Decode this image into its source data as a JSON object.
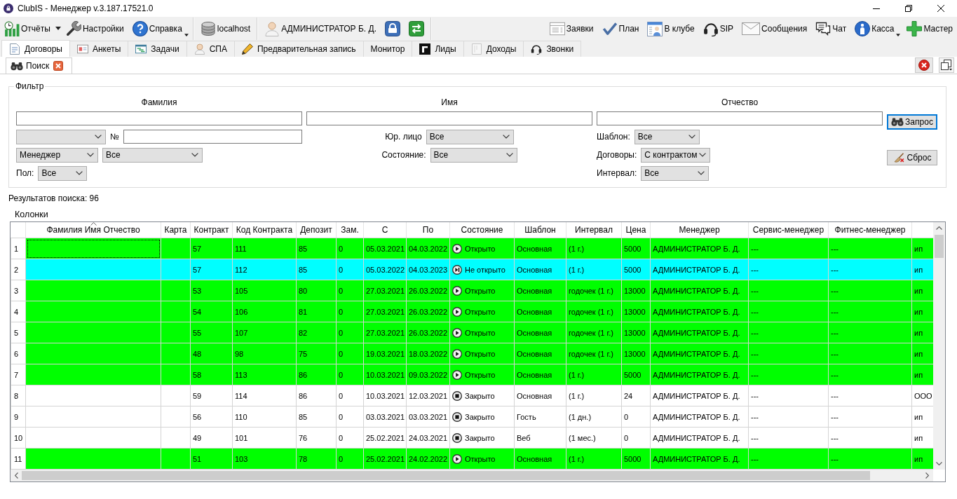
{
  "window": {
    "title": "ClubIS - Менеджер v.3.187.17521.0"
  },
  "toolbar": {
    "left_groups": [
      [
        {
          "kind": "reports",
          "label": "Отчёты",
          "dropdown": true,
          "split": true
        },
        {
          "kind": "settings",
          "label": "Настройки",
          "dropdown": false
        },
        {
          "kind": "help",
          "label": "Справка",
          "dropdown": true,
          "split": false
        }
      ],
      [
        {
          "kind": "server",
          "label": "localhost",
          "dropdown": false
        }
      ],
      [
        {
          "kind": "user",
          "label": "АДМИНИСТРАТОР Б. Д.",
          "dropdown": false
        },
        {
          "kind": "lock",
          "dropdown": false
        },
        {
          "kind": "switch",
          "dropdown": false
        }
      ]
    ],
    "right": [
      {
        "kind": "requests",
        "label": "Заявки",
        "dropdown": false
      },
      {
        "kind": "plan",
        "label": "План",
        "dropdown": false
      },
      {
        "kind": "in_club",
        "label": "В клубе",
        "dropdown": false
      },
      {
        "kind": "sip",
        "label": "SIP",
        "dropdown": false
      },
      {
        "kind": "messages",
        "label": "Сообщения",
        "dropdown": false
      },
      {
        "kind": "chat",
        "label": "Чат",
        "dropdown": false
      },
      {
        "kind": "cash",
        "label": "Касса",
        "dropdown": true,
        "split": false
      },
      {
        "kind": "wizard",
        "label": "Мастер",
        "dropdown": false
      }
    ]
  },
  "tabs": [
    {
      "kind": "contracts",
      "label": "Договоры",
      "selected": true
    },
    {
      "kind": "forms",
      "label": "Анкеты",
      "selected": false
    },
    {
      "kind": "tasks",
      "label": "Задачи",
      "selected": false
    },
    {
      "kind": "spa",
      "label": "СПА",
      "selected": false
    },
    {
      "kind": "booking",
      "label": "Предварительная запись",
      "selected": false
    },
    {
      "kind": "monitor",
      "label": "Монитор",
      "selected": false
    },
    {
      "kind": "leads",
      "label": "Лиды",
      "selected": false
    },
    {
      "kind": "income",
      "label": "Доходы",
      "selected": false
    },
    {
      "kind": "calls",
      "label": "Звонки",
      "selected": false
    }
  ],
  "subtabs": [
    {
      "label": "Поиск",
      "selected": true
    }
  ],
  "filter": {
    "title": "Фильтр",
    "name_fields": [
      {
        "label": "Фамилия"
      },
      {
        "label": "Имя"
      },
      {
        "label": "Отчество"
      }
    ],
    "left": [
      [
        {
          "kind": "select"
        },
        {
          "kind": "label",
          "text": "№"
        },
        {
          "kind": "input"
        }
      ],
      [
        {
          "kind": "select",
          "value": "Менеджер"
        },
        {
          "kind": "select",
          "value": "Все"
        }
      ],
      [
        {
          "kind": "label",
          "text": "Пол:"
        },
        {
          "kind": "select",
          "value": "Все"
        }
      ]
    ],
    "middle": [
      [
        {
          "kind": "label",
          "text": "Юр. лицо"
        },
        {
          "kind": "select",
          "value": "Все"
        }
      ],
      [
        {
          "kind": "label",
          "text": "Состояние:"
        },
        {
          "kind": "select",
          "value": "Все"
        }
      ]
    ],
    "right": [
      [
        {
          "kind": "label",
          "text": "Шаблон:"
        },
        {
          "kind": "select",
          "value": "Все"
        }
      ],
      [
        {
          "kind": "label",
          "text": "Договоры:"
        },
        {
          "kind": "select",
          "value": "С контрактом"
        }
      ],
      [
        {
          "kind": "label",
          "text": "Интервал:"
        },
        {
          "kind": "select",
          "value": "Все"
        }
      ]
    ],
    "buttons": [
      {
        "kind": "search",
        "label": "Запрос",
        "focused": true
      },
      {
        "kind": "reset",
        "label": "Сброс",
        "focused": false
      }
    ]
  },
  "results": "Результатов поиска: 96",
  "columns_label": "Колонки",
  "table": {
    "columns": [
      {
        "label": "Фамилия Имя Отчество",
        "sorted": true
      },
      {
        "label": "Карта",
        "sorted": false
      },
      {
        "label": "Контракт",
        "sorted": false
      },
      {
        "label": "Код Контракта",
        "sorted": false
      },
      {
        "label": "Депозит",
        "sorted": false
      },
      {
        "label": "Зам.",
        "sorted": false
      },
      {
        "label": "С",
        "sorted": false
      },
      {
        "label": "По",
        "sorted": false
      },
      {
        "label": "Состояние",
        "sorted": false
      },
      {
        "label": "Шаблон",
        "sorted": false
      },
      {
        "label": "Интервал",
        "sorted": false
      },
      {
        "label": "Цена",
        "sorted": false
      },
      {
        "label": "Менеджер",
        "sorted": false
      },
      {
        "label": "Сервис-менеджер",
        "sorted": false
      },
      {
        "label": "Фитнес-менеджер",
        "sorted": false
      }
    ],
    "rows": [
      {
        "number": "1",
        "color": "#00ff00",
        "selected": true,
        "kind": "open",
        "contract": "57",
        "contract_code": "111",
        "deposit": "85",
        "frozen": "0",
        "from": "05.03.2021",
        "to": "04.03.2022",
        "state": "Открыто",
        "template": "Основная",
        "interval": "(1 г.)",
        "price": "5000",
        "manager": "АДМИНИСТРАТОР Б. Д.",
        "service_manager": "---",
        "fitness_manager": "---",
        "column_16": "ип"
      },
      {
        "number": "2",
        "color": "#00ffff",
        "selected": false,
        "kind": "pending",
        "contract": "57",
        "contract_code": "112",
        "deposit": "85",
        "frozen": "0",
        "from": "05.03.2022",
        "to": "04.03.2023",
        "state": "Не открыто",
        "template": "Основная",
        "interval": "(1 г.)",
        "price": "5000",
        "manager": "АДМИНИСТРАТОР Б. Д.",
        "service_manager": "---",
        "fitness_manager": "---",
        "column_16": "ип"
      },
      {
        "number": "3",
        "color": "#00ff00",
        "selected": false,
        "kind": "open",
        "contract": "53",
        "contract_code": "105",
        "deposit": "80",
        "frozen": "0",
        "from": "27.03.2021",
        "to": "26.03.2022",
        "state": "Открыто",
        "template": "Основная",
        "interval": "годочек (1 г.)",
        "price": "13000",
        "manager": "АДМИНИСТРАТОР Б. Д.",
        "service_manager": "---",
        "fitness_manager": "---",
        "column_16": "ип"
      },
      {
        "number": "4",
        "color": "#00ff00",
        "selected": false,
        "kind": "open",
        "contract": "54",
        "contract_code": "106",
        "deposit": "81",
        "frozen": "0",
        "from": "27.03.2021",
        "to": "26.03.2022",
        "state": "Открыто",
        "template": "Основная",
        "interval": "годочек (1 г.)",
        "price": "13000",
        "manager": "АДМИНИСТРАТОР Б. Д.",
        "service_manager": "---",
        "fitness_manager": "---",
        "column_16": "ип"
      },
      {
        "number": "5",
        "color": "#00ff00",
        "selected": false,
        "kind": "open",
        "contract": "55",
        "contract_code": "107",
        "deposit": "82",
        "frozen": "0",
        "from": "27.03.2021",
        "to": "26.03.2022",
        "state": "Открыто",
        "template": "Основная",
        "interval": "годочек (1 г.)",
        "price": "13000",
        "manager": "АДМИНИСТРАТОР Б. Д.",
        "service_manager": "---",
        "fitness_manager": "---",
        "column_16": "ип"
      },
      {
        "number": "6",
        "color": "#00ff00",
        "selected": false,
        "kind": "open",
        "contract": "48",
        "contract_code": "98",
        "deposit": "75",
        "frozen": "0",
        "from": "19.03.2021",
        "to": "18.03.2022",
        "state": "Открыто",
        "template": "Основная",
        "interval": "годочек (1 г.)",
        "price": "13000",
        "manager": "АДМИНИСТРАТОР Б. Д.",
        "service_manager": "---",
        "fitness_manager": "---",
        "column_16": "ип"
      },
      {
        "number": "7",
        "color": "#00ff00",
        "selected": false,
        "kind": "open",
        "contract": "58",
        "contract_code": "113",
        "deposit": "86",
        "frozen": "0",
        "from": "10.03.2021",
        "to": "09.03.2022",
        "state": "Открыто",
        "template": "Основная",
        "interval": "(1 г.)",
        "price": "5000",
        "manager": "АДМИНИСТРАТОР Б. Д.",
        "service_manager": "---",
        "fitness_manager": "---",
        "column_16": "ип"
      },
      {
        "number": "8",
        "color": "#ffffff",
        "selected": false,
        "kind": "closed",
        "contract": "59",
        "contract_code": "114",
        "deposit": "86",
        "frozen": "0",
        "from": "10.03.2021",
        "to": "12.03.2021",
        "state": "Закрыто",
        "template": "Основная",
        "interval": "(1 г.)",
        "price": "24",
        "manager": "АДМИНИСТРАТОР Б. Д.",
        "service_manager": "---",
        "fitness_manager": "---",
        "column_16": "ООО"
      },
      {
        "number": "9",
        "color": "#ffffff",
        "selected": false,
        "kind": "closed",
        "contract": "56",
        "contract_code": "110",
        "deposit": "85",
        "frozen": "0",
        "from": "03.03.2021",
        "to": "03.03.2021",
        "state": "Закрыто",
        "template": "Гость",
        "interval": "(1 дн.)",
        "price": "0",
        "manager": "АДМИНИСТРАТОР Б. Д.",
        "service_manager": "---",
        "fitness_manager": "---",
        "column_16": "ип"
      },
      {
        "number": "10",
        "color": "#ffffff",
        "selected": false,
        "kind": "closed",
        "contract": "49",
        "contract_code": "101",
        "deposit": "76",
        "frozen": "0",
        "from": "25.02.2021",
        "to": "24.03.2021",
        "state": "Закрыто",
        "template": "Веб",
        "interval": "(1 мес.)",
        "price": "0",
        "manager": "АДМИНИСТРАТОР Б. Д.",
        "service_manager": "---",
        "fitness_manager": "---",
        "column_16": "ип"
      },
      {
        "number": "11",
        "color": "#00ff00",
        "selected": false,
        "kind": "open",
        "contract": "51",
        "contract_code": "103",
        "deposit": "78",
        "frozen": "0",
        "from": "25.02.2021",
        "to": "24.02.2022",
        "state": "Открыто",
        "template": "Основная",
        "interval": "(1 г.)",
        "price": "5000",
        "manager": "АДМИНИСТРАТОР Б. Д.",
        "service_manager": "---",
        "fitness_manager": "---",
        "column_16": "ип"
      }
    ]
  }
}
